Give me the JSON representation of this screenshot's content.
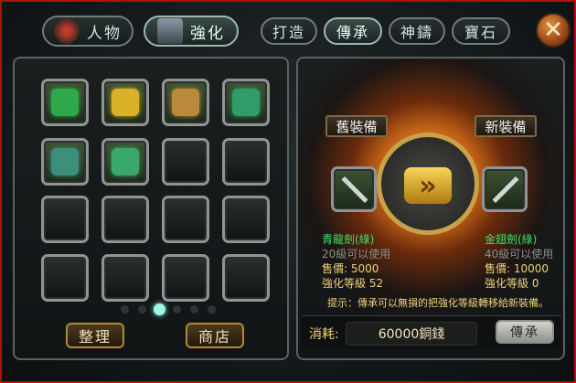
{
  "tabs": [
    {
      "label": "人物"
    },
    {
      "label": "強化"
    },
    {
      "label": "打造"
    },
    {
      "label": "傳承"
    },
    {
      "label": "神鑄"
    },
    {
      "label": "寶石"
    }
  ],
  "inventory": {
    "items": [
      "green-chest-item",
      "gold-ingot-item",
      "treasure-chest-item",
      "green-robe-item",
      "jade-pendant-item",
      "jade-amulet-item"
    ],
    "dots": {
      "total": 6,
      "active": 2
    },
    "sort_label": "整理",
    "shop_label": "商店"
  },
  "inherit": {
    "old_label": "舊裝備",
    "new_label": "新裝備",
    "old": {
      "name": "青龍劍(綠)",
      "level": "20級可以使用",
      "price": "售價: 5000",
      "enhance": "強化等級 52"
    },
    "new": {
      "name": "金翅劍(綠)",
      "level": "40級可以使用",
      "price": "售價: 10000",
      "enhance": "強化等級 0"
    },
    "hint": "提示：傳承可以無損的把強化等級轉移給新裝備。",
    "cost_label": "消耗:",
    "cost_value": "60000銅錢",
    "button_label": "傳承"
  },
  "colors": {
    "accent": "#b01010",
    "name_green": "#3fe06a",
    "gold": "#f0d27a",
    "gray": "#8a8f8c"
  }
}
